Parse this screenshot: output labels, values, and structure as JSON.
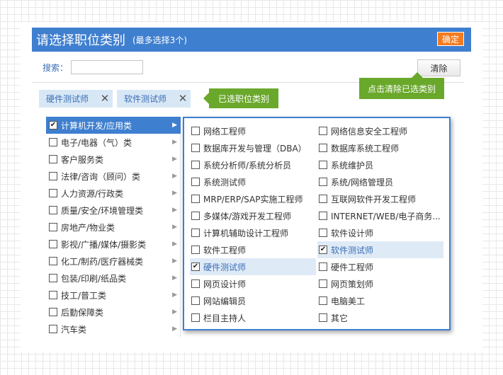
{
  "header": {
    "title": "请选择职位类别",
    "subtitle": "(最多选择3个)",
    "ok_label": "确定"
  },
  "search": {
    "label": "搜索：",
    "value": "",
    "placeholder": ""
  },
  "clear_label": "清除",
  "tips": {
    "clear_tip": "点击清除已选类别",
    "selected_tip": "已选职位类别"
  },
  "selected": [
    {
      "label": "硬件测试师"
    },
    {
      "label": "软件测试师"
    }
  ],
  "categories": [
    {
      "label": "计算机开发/应用类",
      "checked": true,
      "active": true
    },
    {
      "label": "电子/电器（气）类",
      "checked": false
    },
    {
      "label": "客户服务类",
      "checked": false
    },
    {
      "label": "法律/咨询（顾问）类",
      "checked": false
    },
    {
      "label": "人力资源/行政类",
      "checked": false
    },
    {
      "label": "质量/安全/环境管理类",
      "checked": false
    },
    {
      "label": "房地产/物业类",
      "checked": false
    },
    {
      "label": "影视/广播/媒体/摄影类",
      "checked": false
    },
    {
      "label": "化工/制药/医疗器械类",
      "checked": false
    },
    {
      "label": "包装/印刷/纸品类",
      "checked": false
    },
    {
      "label": "技工/普工类",
      "checked": false
    },
    {
      "label": "后勤保障类",
      "checked": false
    },
    {
      "label": "汽车类",
      "checked": false
    }
  ],
  "jobs": [
    {
      "label": "网络工程师",
      "checked": false
    },
    {
      "label": "网络信息安全工程师",
      "checked": false
    },
    {
      "label": "数据库开发与管理（DBA）",
      "checked": false
    },
    {
      "label": "数据库系统工程师",
      "checked": false
    },
    {
      "label": "系统分析师/系统分析员",
      "checked": false
    },
    {
      "label": "系统维护员",
      "checked": false
    },
    {
      "label": "系统测试师",
      "checked": false
    },
    {
      "label": "系统/网络管理员",
      "checked": false
    },
    {
      "label": "MRP/ERP/SAP实施工程师",
      "checked": false
    },
    {
      "label": "互联网软件开发工程师",
      "checked": false
    },
    {
      "label": "多媒体/游戏开发工程师",
      "checked": false
    },
    {
      "label": "INTERNET/WEB/电子商务...",
      "checked": false
    },
    {
      "label": "计算机辅助设计工程师",
      "checked": false
    },
    {
      "label": "软件设计师",
      "checked": false
    },
    {
      "label": "软件工程师",
      "checked": false
    },
    {
      "label": "软件测试师",
      "checked": true
    },
    {
      "label": "硬件测试师",
      "checked": true
    },
    {
      "label": "硬件工程师",
      "checked": false
    },
    {
      "label": "网页设计师",
      "checked": false
    },
    {
      "label": "网页策划师",
      "checked": false
    },
    {
      "label": "网站编辑员",
      "checked": false
    },
    {
      "label": "电脑美工",
      "checked": false
    },
    {
      "label": "栏目主持人",
      "checked": false
    },
    {
      "label": "其它",
      "checked": false
    }
  ],
  "colors": {
    "primary": "#3f7fcf",
    "accent": "#f47b20",
    "tip": "#6aa82b"
  }
}
